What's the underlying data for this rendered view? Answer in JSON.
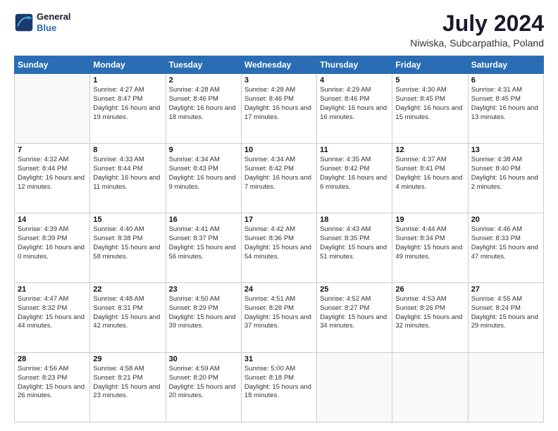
{
  "logo": {
    "line1": "General",
    "line2": "Blue"
  },
  "title": "July 2024",
  "subtitle": "Niwiska, Subcarpathia, Poland",
  "days_of_week": [
    "Sunday",
    "Monday",
    "Tuesday",
    "Wednesday",
    "Thursday",
    "Friday",
    "Saturday"
  ],
  "weeks": [
    [
      {
        "num": "",
        "info": ""
      },
      {
        "num": "1",
        "info": "Sunrise: 4:27 AM\nSunset: 8:47 PM\nDaylight: 16 hours\nand 19 minutes."
      },
      {
        "num": "2",
        "info": "Sunrise: 4:28 AM\nSunset: 8:46 PM\nDaylight: 16 hours\nand 18 minutes."
      },
      {
        "num": "3",
        "info": "Sunrise: 4:28 AM\nSunset: 8:46 PM\nDaylight: 16 hours\nand 17 minutes."
      },
      {
        "num": "4",
        "info": "Sunrise: 4:29 AM\nSunset: 8:46 PM\nDaylight: 16 hours\nand 16 minutes."
      },
      {
        "num": "5",
        "info": "Sunrise: 4:30 AM\nSunset: 8:45 PM\nDaylight: 16 hours\nand 15 minutes."
      },
      {
        "num": "6",
        "info": "Sunrise: 4:31 AM\nSunset: 8:45 PM\nDaylight: 16 hours\nand 13 minutes."
      }
    ],
    [
      {
        "num": "7",
        "info": "Sunrise: 4:32 AM\nSunset: 8:44 PM\nDaylight: 16 hours\nand 12 minutes."
      },
      {
        "num": "8",
        "info": "Sunrise: 4:33 AM\nSunset: 8:44 PM\nDaylight: 16 hours\nand 11 minutes."
      },
      {
        "num": "9",
        "info": "Sunrise: 4:34 AM\nSunset: 8:43 PM\nDaylight: 16 hours\nand 9 minutes."
      },
      {
        "num": "10",
        "info": "Sunrise: 4:34 AM\nSunset: 8:42 PM\nDaylight: 16 hours\nand 7 minutes."
      },
      {
        "num": "11",
        "info": "Sunrise: 4:35 AM\nSunset: 8:42 PM\nDaylight: 16 hours\nand 6 minutes."
      },
      {
        "num": "12",
        "info": "Sunrise: 4:37 AM\nSunset: 8:41 PM\nDaylight: 16 hours\nand 4 minutes."
      },
      {
        "num": "13",
        "info": "Sunrise: 4:38 AM\nSunset: 8:40 PM\nDaylight: 16 hours\nand 2 minutes."
      }
    ],
    [
      {
        "num": "14",
        "info": "Sunrise: 4:39 AM\nSunset: 8:39 PM\nDaylight: 16 hours\nand 0 minutes."
      },
      {
        "num": "15",
        "info": "Sunrise: 4:40 AM\nSunset: 8:38 PM\nDaylight: 15 hours\nand 58 minutes."
      },
      {
        "num": "16",
        "info": "Sunrise: 4:41 AM\nSunset: 8:37 PM\nDaylight: 15 hours\nand 56 minutes."
      },
      {
        "num": "17",
        "info": "Sunrise: 4:42 AM\nSunset: 8:36 PM\nDaylight: 15 hours\nand 54 minutes."
      },
      {
        "num": "18",
        "info": "Sunrise: 4:43 AM\nSunset: 8:35 PM\nDaylight: 15 hours\nand 51 minutes."
      },
      {
        "num": "19",
        "info": "Sunrise: 4:44 AM\nSunset: 8:34 PM\nDaylight: 15 hours\nand 49 minutes."
      },
      {
        "num": "20",
        "info": "Sunrise: 4:46 AM\nSunset: 8:33 PM\nDaylight: 15 hours\nand 47 minutes."
      }
    ],
    [
      {
        "num": "21",
        "info": "Sunrise: 4:47 AM\nSunset: 8:32 PM\nDaylight: 15 hours\nand 44 minutes."
      },
      {
        "num": "22",
        "info": "Sunrise: 4:48 AM\nSunset: 8:31 PM\nDaylight: 15 hours\nand 42 minutes."
      },
      {
        "num": "23",
        "info": "Sunrise: 4:50 AM\nSunset: 8:29 PM\nDaylight: 15 hours\nand 39 minutes."
      },
      {
        "num": "24",
        "info": "Sunrise: 4:51 AM\nSunset: 8:28 PM\nDaylight: 15 hours\nand 37 minutes."
      },
      {
        "num": "25",
        "info": "Sunrise: 4:52 AM\nSunset: 8:27 PM\nDaylight: 15 hours\nand 34 minutes."
      },
      {
        "num": "26",
        "info": "Sunrise: 4:53 AM\nSunset: 8:26 PM\nDaylight: 15 hours\nand 32 minutes."
      },
      {
        "num": "27",
        "info": "Sunrise: 4:55 AM\nSunset: 8:24 PM\nDaylight: 15 hours\nand 29 minutes."
      }
    ],
    [
      {
        "num": "28",
        "info": "Sunrise: 4:56 AM\nSunset: 8:23 PM\nDaylight: 15 hours\nand 26 minutes."
      },
      {
        "num": "29",
        "info": "Sunrise: 4:58 AM\nSunset: 8:21 PM\nDaylight: 15 hours\nand 23 minutes."
      },
      {
        "num": "30",
        "info": "Sunrise: 4:59 AM\nSunset: 8:20 PM\nDaylight: 15 hours\nand 20 minutes."
      },
      {
        "num": "31",
        "info": "Sunrise: 5:00 AM\nSunset: 8:18 PM\nDaylight: 15 hours\nand 18 minutes."
      },
      {
        "num": "",
        "info": ""
      },
      {
        "num": "",
        "info": ""
      },
      {
        "num": "",
        "info": ""
      }
    ]
  ]
}
